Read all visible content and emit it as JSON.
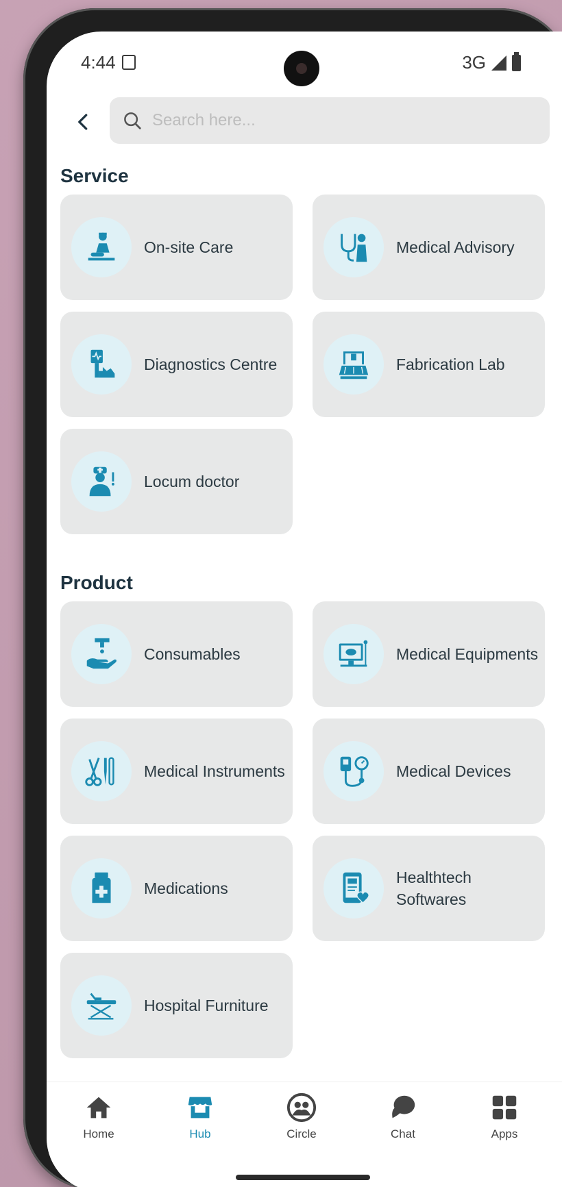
{
  "status_bar": {
    "time": "4:44",
    "network": "3G"
  },
  "search": {
    "placeholder": "Search here..."
  },
  "sections": {
    "service": {
      "title": "Service",
      "items": [
        {
          "label": "On-site Care",
          "icon": "onsite-care-icon"
        },
        {
          "label": "Medical Advisory",
          "icon": "medical-advisory-icon"
        },
        {
          "label": "Diagnostics Centre",
          "icon": "diagnostics-icon"
        },
        {
          "label": "Fabrication Lab",
          "icon": "fabrication-lab-icon"
        },
        {
          "label": "Locum doctor",
          "icon": "locum-doctor-icon"
        }
      ]
    },
    "product": {
      "title": "Product",
      "items": [
        {
          "label": "Consumables",
          "icon": "consumables-icon"
        },
        {
          "label": "Medical Equipments",
          "icon": "medical-equipment-icon"
        },
        {
          "label": "Medical Instruments",
          "icon": "medical-instruments-icon"
        },
        {
          "label": "Medical Devices",
          "icon": "medical-devices-icon"
        },
        {
          "label": "Medications",
          "icon": "medications-icon"
        },
        {
          "label": "Healthtech Softwares",
          "icon": "healthtech-icon"
        },
        {
          "label": "Hospital Furniture",
          "icon": "hospital-furniture-icon"
        }
      ]
    }
  },
  "nav": {
    "items": [
      {
        "label": "Home",
        "icon": "home-icon"
      },
      {
        "label": "Hub",
        "icon": "hub-icon",
        "active": true
      },
      {
        "label": "Circle",
        "icon": "circle-icon"
      },
      {
        "label": "Chat",
        "icon": "chat-icon"
      },
      {
        "label": "Apps",
        "icon": "apps-icon"
      }
    ]
  },
  "colors": {
    "accent": "#1b8bb1",
    "card_bg": "#e7e8e8",
    "icon_bg": "#dff1f6",
    "title": "#1e3340"
  }
}
